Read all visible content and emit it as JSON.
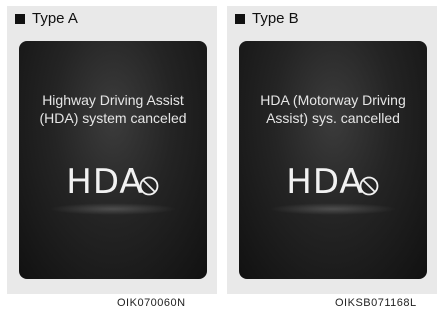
{
  "panels": [
    {
      "type_label": "Type A",
      "message_line1": "Highway Driving Assist",
      "message_line2": "(HDA) system canceled",
      "hda_text": "HDA",
      "code": "OIK070060N"
    },
    {
      "type_label": "Type B",
      "message_line1": "HDA (Motorway Driving",
      "message_line2": "Assist) sys. cancelled",
      "hda_text": "HDA",
      "code": "OIKSB071168L"
    }
  ]
}
